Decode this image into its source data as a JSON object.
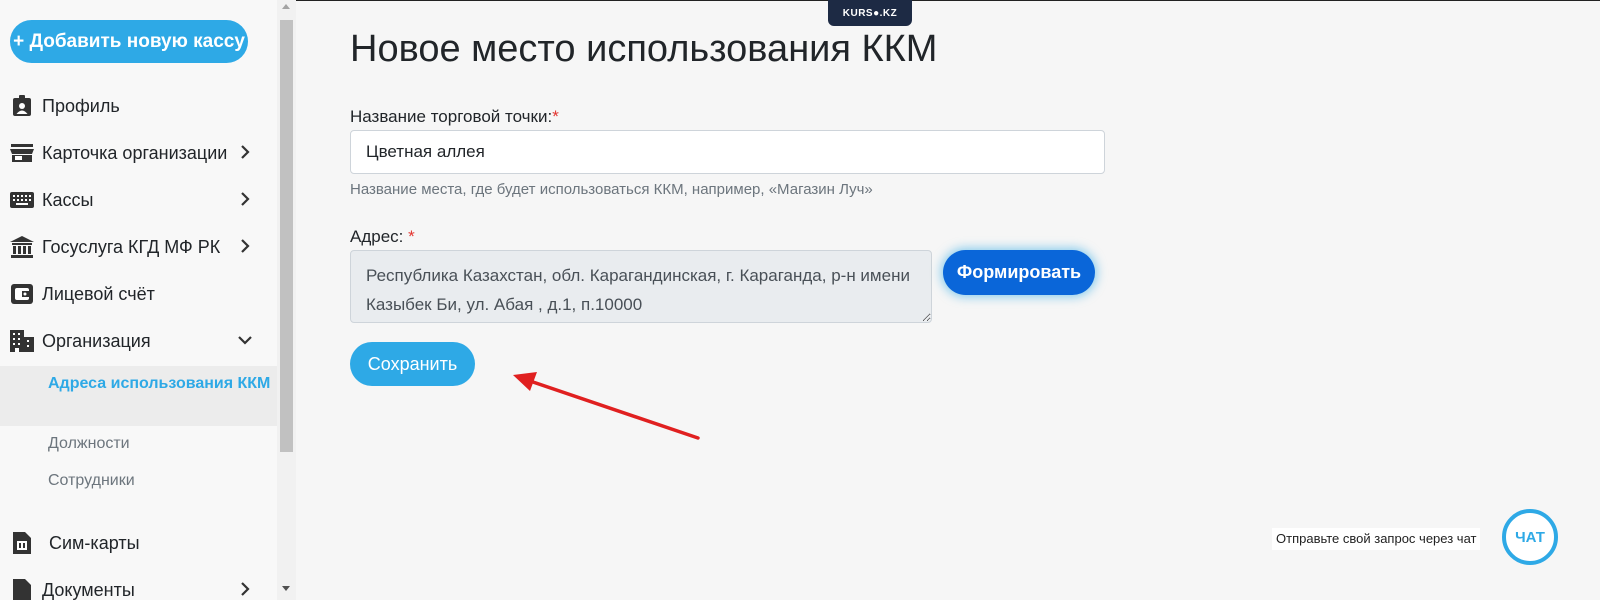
{
  "sidebar": {
    "add_button": "+ Добавить новую кассу",
    "items": [
      {
        "label": "Профиль",
        "icon": "profile-badge-icon",
        "has_chevron": false
      },
      {
        "label": "Карточка организации",
        "icon": "store-icon",
        "has_chevron": true
      },
      {
        "label": "Кассы",
        "icon": "keyboard-icon",
        "has_chevron": true
      },
      {
        "label": "Госуслуга КГД МФ РК",
        "icon": "government-building-icon",
        "has_chevron": true
      },
      {
        "label": "Лицевой счёт",
        "icon": "wallet-icon",
        "has_chevron": false
      },
      {
        "label": "Организация",
        "icon": "office-building-icon",
        "has_chevron": true,
        "expanded": true
      },
      {
        "label": "Сим-карты",
        "icon": "sim-card-icon",
        "has_chevron": false
      },
      {
        "label": "Документы",
        "icon": "document-icon",
        "has_chevron": true
      }
    ],
    "subitems": [
      {
        "label": "Адреса использования ККМ",
        "active": true
      },
      {
        "label": "Должности",
        "active": false
      },
      {
        "label": "Сотрудники",
        "active": false
      }
    ]
  },
  "header": {
    "logo_text": "KURS●.KZ"
  },
  "main": {
    "title": "Новое место использования ККМ",
    "name_field": {
      "label": "Название торговой точки:",
      "required_mark": "*",
      "value": "Цветная аллея",
      "hint": "Название места, где будет использоваться ККМ, например, «Магазин Луч»"
    },
    "address_field": {
      "label": "Адрес:",
      "required_mark": "*",
      "value": "Республика Казахстан, обл. Карагандинская, г. Караганда, р-н имени Казыбек Би, ул. Абая , д.1, п.10000"
    },
    "form_button": "Формировать",
    "save_button": "Сохранить"
  },
  "chat": {
    "prompt": "Отправьте свой запрос через чат",
    "button": "ЧАТ"
  },
  "colors": {
    "accent": "#2ea9e6",
    "primary_dark": "#0a66d9",
    "required": "#e3342f",
    "arrow": "#e02020"
  }
}
